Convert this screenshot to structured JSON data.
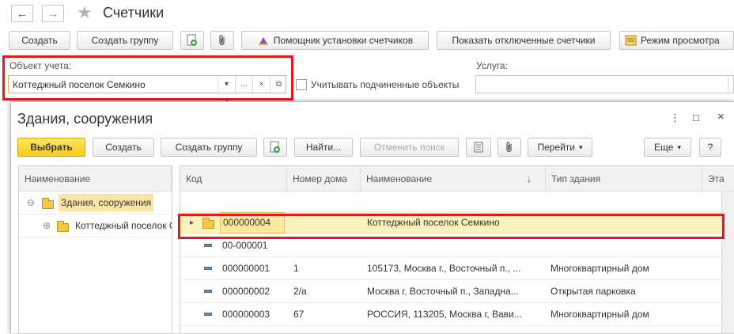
{
  "window": {
    "title": "Счетчики",
    "back_icon": "←",
    "forward_icon": "→",
    "star_icon": "★"
  },
  "toolbar": {
    "create": "Создать",
    "create_group": "Создать группу",
    "wizard": "Помощник установки счетчиков",
    "show_disabled": "Показать отключенные счетчики",
    "view_mode": "Режим просмотра"
  },
  "filter": {
    "object_label": "Объект учета:",
    "object_value": "Коттеджный поселок Семкино",
    "dropdown_glyph": "▾",
    "ellipsis_glyph": "...",
    "clear_glyph": "×",
    "open_glyph": "⧉",
    "include_sub_label": "Учитывать подчиненные объекты",
    "service_label": "Услуга:"
  },
  "dialog": {
    "title": "Здания, сооружения",
    "more_icon": "⋮",
    "maximize_icon": "□",
    "close_icon": "×",
    "toolbar": {
      "select": "Выбрать",
      "create": "Создать",
      "create_group": "Создать группу",
      "find": "Найти...",
      "cancel_search": "Отменить поиск",
      "goto": "Перейти",
      "more": "Еще",
      "help": "?"
    },
    "tree": {
      "header": "Наименование",
      "nodes": [
        {
          "label": "Здания, сооружения",
          "toggle": "⊖"
        },
        {
          "label": "Коттеджный поселок Семкино",
          "toggle": "⊕"
        }
      ]
    },
    "table": {
      "columns": [
        "Код",
        "Номер дома",
        "Наименование",
        "Тип здания",
        "Эта"
      ],
      "sort_icon": "↓",
      "expand_icon": "▸",
      "rows": [
        {
          "code": "000000004",
          "house": "",
          "name": "Коттеджный поселок Семкино",
          "type": "",
          "kind": "folder"
        },
        {
          "code": "00-000001",
          "house": "",
          "name": "",
          "type": "",
          "kind": "item"
        },
        {
          "code": "000000001",
          "house": "1",
          "name": "105173, Москва г., Восточный п., ...",
          "type": "Многоквартирный дом",
          "kind": "item"
        },
        {
          "code": "000000002",
          "house": "2/а",
          "name": "Москва г, Восточный п., Западна...",
          "type": "Открытая парковка",
          "kind": "item"
        },
        {
          "code": "000000003",
          "house": "67",
          "name": "РОССИЯ, 113205, Москва г, Вави...",
          "type": "Многоквартирный дом",
          "kind": "item"
        }
      ]
    }
  },
  "colors": {
    "highlight_frame": "#e8171f",
    "selected_row": "#fbf1bb",
    "accent_button": "#f6cc1a"
  }
}
